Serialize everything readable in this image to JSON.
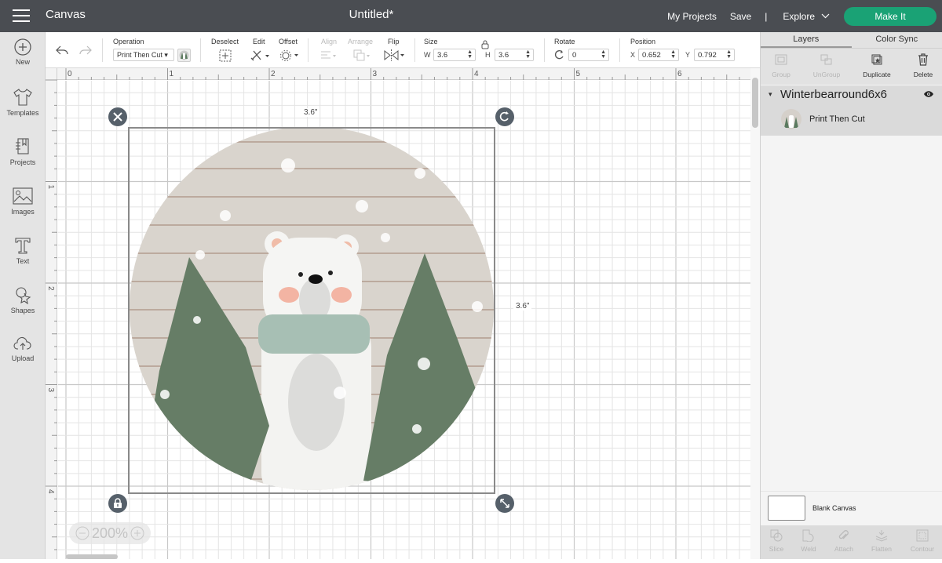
{
  "topbar": {
    "app_name": "Canvas",
    "document_title": "Untitled*",
    "my_projects": "My Projects",
    "save": "Save",
    "separator": "|",
    "explore": "Explore",
    "make_it": "Make It",
    "make_it_color": "#1aa275"
  },
  "sidebar": {
    "items": [
      {
        "label": "New",
        "icon": "plus-circle-icon"
      },
      {
        "label": "Templates",
        "icon": "tshirt-icon"
      },
      {
        "label": "Projects",
        "icon": "notebook-icon"
      },
      {
        "label": "Images",
        "icon": "image-icon"
      },
      {
        "label": "Text",
        "icon": "text-t-icon"
      },
      {
        "label": "Shapes",
        "icon": "shapes-icon"
      },
      {
        "label": "Upload",
        "icon": "cloud-upload-icon"
      }
    ]
  },
  "toolbar": {
    "operation_label": "Operation",
    "operation_value": "Print Then Cut",
    "deselect_label": "Deselect",
    "edit_label": "Edit",
    "offset_label": "Offset",
    "align_label": "Align",
    "arrange_label": "Arrange",
    "flip_label": "Flip",
    "size_label": "Size",
    "w_label": "W",
    "w_value": "3.6",
    "h_label": "H",
    "h_value": "3.6",
    "rotate_label": "Rotate",
    "rotate_value": "0",
    "position_label": "Position",
    "x_label": "X",
    "x_value": "0.652",
    "y_label": "Y",
    "y_value": "0.792"
  },
  "rulers": {
    "top": [
      "0",
      "1",
      "2",
      "3",
      "4",
      "5",
      "6"
    ],
    "left": [
      "1",
      "2",
      "3",
      "4"
    ]
  },
  "canvas": {
    "width_dim": "3.6\"",
    "height_dim": "3.6\"",
    "zoom": "200%",
    "image_description": "Round winter polar bear with scarf between two pine trees on wood background"
  },
  "layers_panel": {
    "tabs": [
      "Layers",
      "Color Sync"
    ],
    "tools": [
      {
        "label": "Group",
        "enabled": false
      },
      {
        "label": "UnGroup",
        "enabled": false
      },
      {
        "label": "Duplicate",
        "enabled": true
      },
      {
        "label": "Delete",
        "enabled": true
      }
    ],
    "group_name": "Winterbearround6x6",
    "layer_item": "Print Then Cut",
    "blank_canvas": "Blank Canvas",
    "bottom_tools": [
      "Slice",
      "Weld",
      "Attach",
      "Flatten",
      "Contour"
    ]
  }
}
